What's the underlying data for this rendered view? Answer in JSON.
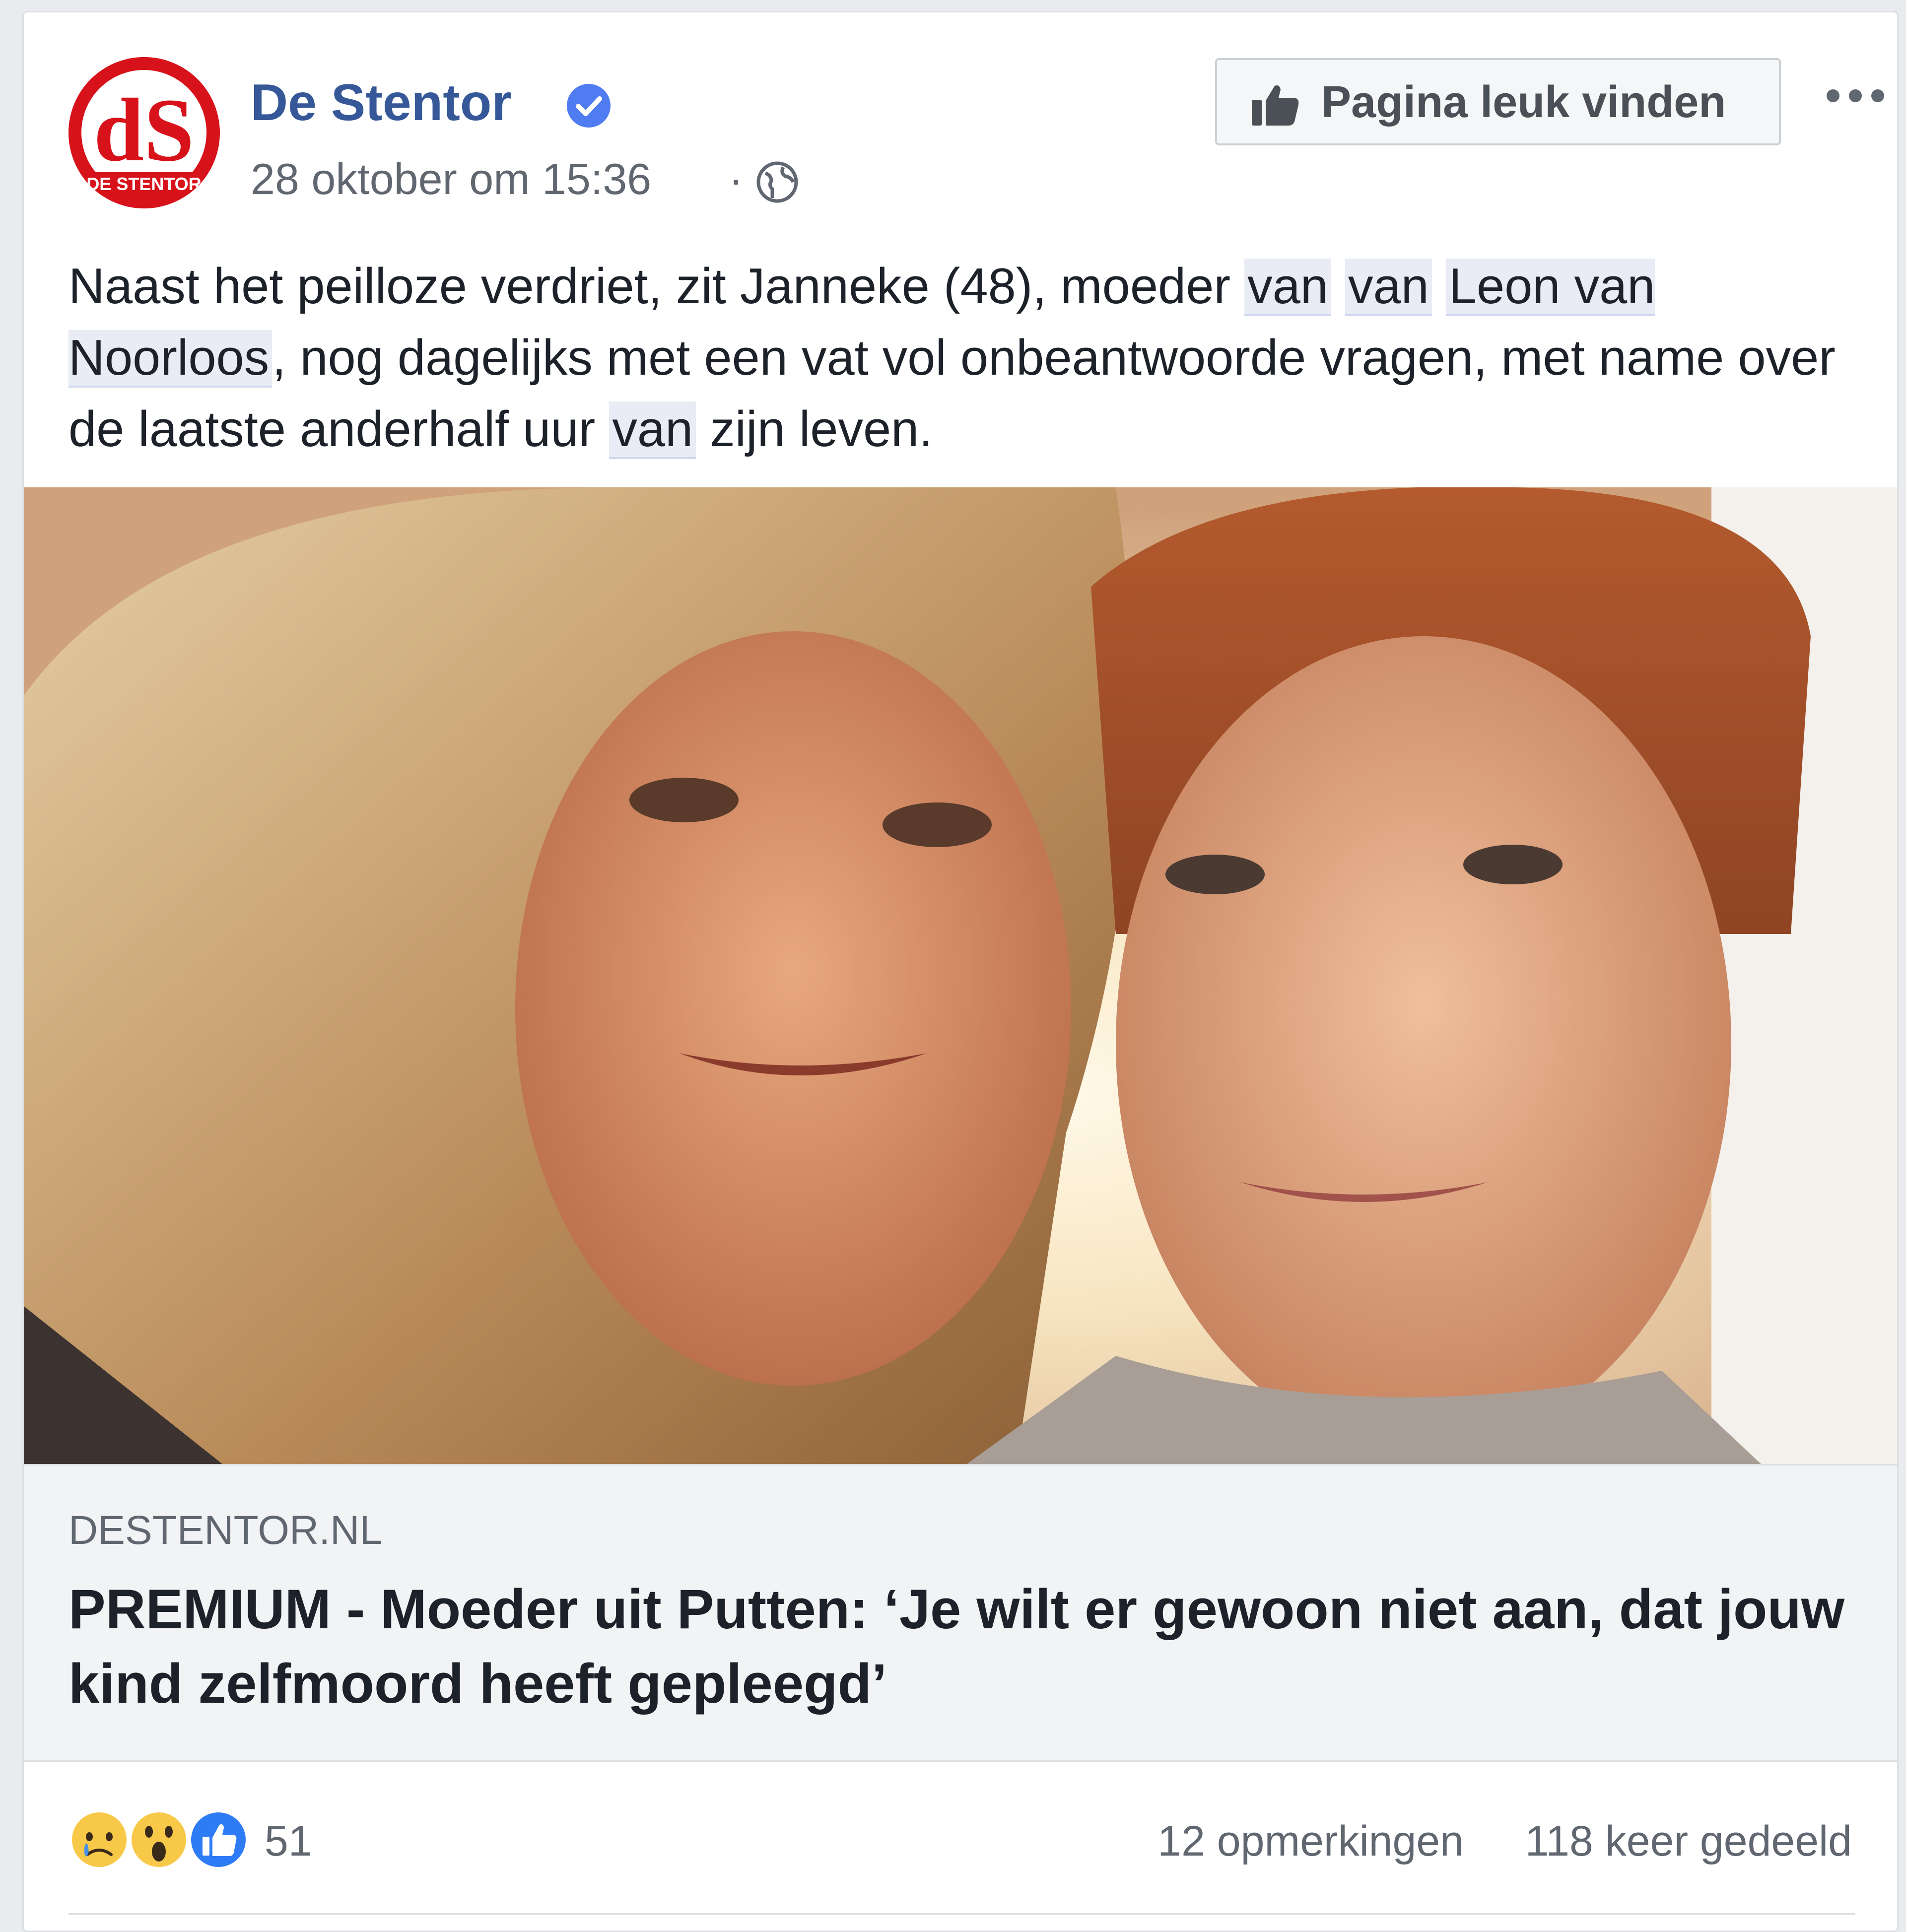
{
  "post": {
    "page_name": "De Stentor",
    "timestamp": "28 oktober om 15:36",
    "separator": "·",
    "like_page_label": "Pagina leuk vinden",
    "avatar_letters": "dS",
    "avatar_caption": "DE STENTOR",
    "text": {
      "part1": "Naast het peilloze verdriet, zit Janneke (48), moeder ",
      "tag1": "van",
      "tag2": "van",
      "tag3": "Leon van Noorloos",
      "part2": ", nog dagelijks met een vat vol onbeantwoorde vragen, met name over de laatste anderhalf uur ",
      "tag4": "van",
      "part3": " zijn leven."
    }
  },
  "link": {
    "domain": "DESTENTOR.NL",
    "title": "PREMIUM - Moeder uit Putten: ‘Je wilt er gewoon niet aan, dat jouw kind zelfmoord heeft gepleegd’"
  },
  "stats": {
    "reactions": [
      "sad",
      "wow",
      "like"
    ],
    "reaction_count": "51",
    "comments": "12 opmerkingen",
    "shares": "118 keer gedeeld"
  },
  "colors": {
    "page_name": "#365899",
    "verified": "#4f7cf0",
    "brand_red": "#d8121b",
    "like_blue": "#2e7bf6"
  }
}
